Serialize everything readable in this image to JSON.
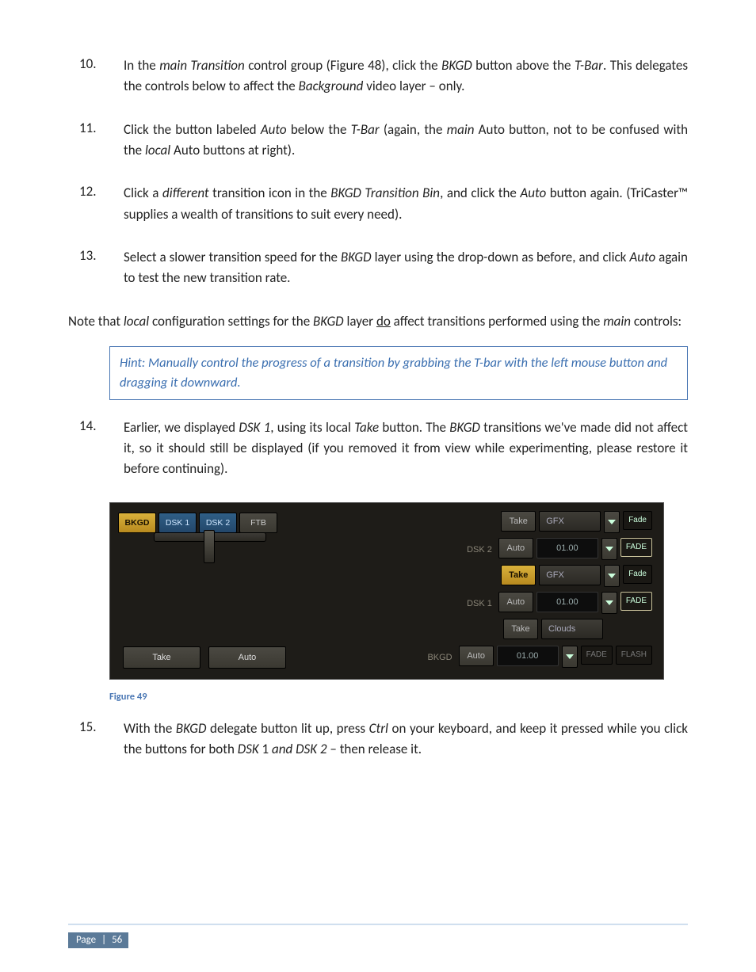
{
  "list": {
    "i10": {
      "n": "10.",
      "t": "In the <em>main Transition</em> control group (Figure 48), click the <em>BKGD</em> button above the <em>T-Bar</em>. This delegates the controls below to affect the <em>Background</em> video layer – only."
    },
    "i11": {
      "n": "11.",
      "t": "Click the button labeled <em>Auto</em> below the <em>T-Bar</em> (again, the <em>main</em> Auto button, not to be confused with the <em>local</em> Auto buttons at right)."
    },
    "i12": {
      "n": "12.",
      "t": "Click a <em>different</em> transition icon in the <em>BKGD Transition Bin</em>, and click the <em>Auto</em> button again. (TriCaster™ supplies a wealth of transitions to suit every need)."
    },
    "i13": {
      "n": "13.",
      "t": "Select a slower transition speed for the <em>BKGD</em> layer using the drop-down as before, and click <em>Auto</em> again to test the new transition rate."
    },
    "i14": {
      "n": "14.",
      "t": "Earlier, we displayed <em>DSK 1</em>, using its local <em>Take</em> button.  The <em>BKGD</em> transitions we've made did not affect it, so it should still be displayed (if you removed it from view while experimenting, please restore it before continuing)."
    },
    "i15": {
      "n": "15.",
      "t": "With the <em>BKGD</em> delegate button lit up, press <em>Ctrl</em> on your keyboard, and keep it pressed while you click the buttons for both <em>DSK</em> 1 <em>and DSK 2</em> – then release it."
    }
  },
  "noteHtml": "Note that <em>local</em> configuration settings for the <em>BKGD</em> layer <span class=\"u\">do</span> affect transitions performed using the <em>main</em> controls:",
  "hint": "Hint: Manually control the progress of a transition by grabbing the T-bar with the left mouse button and dragging it downward.",
  "figureCaption": "Figure 49",
  "ui": {
    "delegates": {
      "bkgd": "BKGD",
      "dsk1": "DSK 1",
      "dsk2": "DSK 2",
      "ftb": "FTB"
    },
    "tbarButtons": {
      "take": "Take",
      "auto": "Auto"
    },
    "rows": {
      "dsk2": {
        "label": "DSK 2",
        "take": "Take",
        "auto": "Auto",
        "name": "GFX",
        "time": "01.00",
        "chip": "FADE",
        "fade": "Fade"
      },
      "dsk1": {
        "label": "DSK 1",
        "take": "Take",
        "auto": "Auto",
        "name": "GFX",
        "time": "01.00",
        "chip": "FADE",
        "fade": "Fade"
      },
      "bkgd": {
        "label": "BKGD",
        "take": "Take",
        "auto": "Auto",
        "name": "Clouds",
        "time": "01.00",
        "chip1": "FADE",
        "chip2": "FLASH"
      }
    }
  },
  "footer": {
    "page": "Page",
    "sep": "|",
    "num": "56"
  }
}
